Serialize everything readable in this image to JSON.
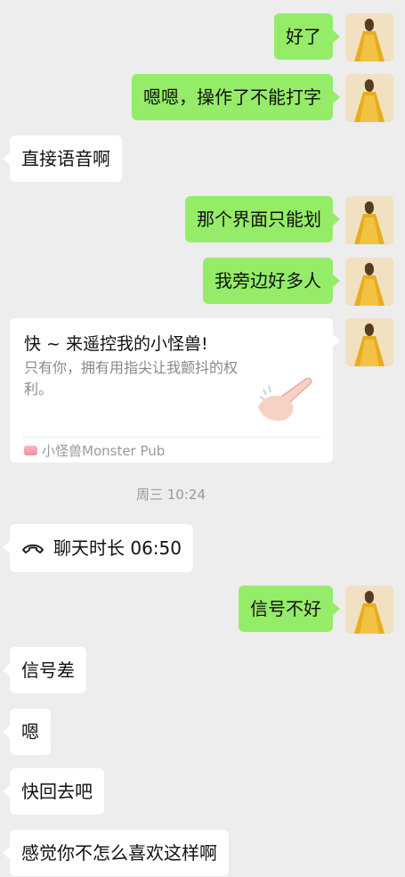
{
  "messages": [
    {
      "side": "me",
      "text": "好了"
    },
    {
      "side": "me",
      "text": "嗯嗯，操作了不能打字"
    },
    {
      "side": "them",
      "text": "直接语音啊"
    },
    {
      "side": "me",
      "text": "那个界面只能划"
    },
    {
      "side": "me",
      "text": "我旁边好多人"
    },
    {
      "side": "them",
      "text": "信号差"
    },
    {
      "side": "them",
      "text": "嗯"
    },
    {
      "side": "them",
      "text": "快回去吧"
    },
    {
      "side": "them",
      "text": "感觉你不怎么喜欢这样啊"
    },
    {
      "side": "me",
      "text": "信号不好"
    }
  ],
  "link_card": {
    "title": "快 ~ 来遥控我的小怪兽!",
    "description": "只有你，拥有用指尖让我颤抖的权利。",
    "source": "小怪兽Monster Pub",
    "thumbnail_icon": "hand-illustration-icon"
  },
  "system": {
    "timestamp": "周三 10:24"
  },
  "call_record": {
    "icon": "phone-hangup-icon",
    "text": "聊天时长 06:50"
  },
  "colors": {
    "background": "#ededed",
    "my_bubble": "#95ec69",
    "their_bubble": "#ffffff"
  }
}
